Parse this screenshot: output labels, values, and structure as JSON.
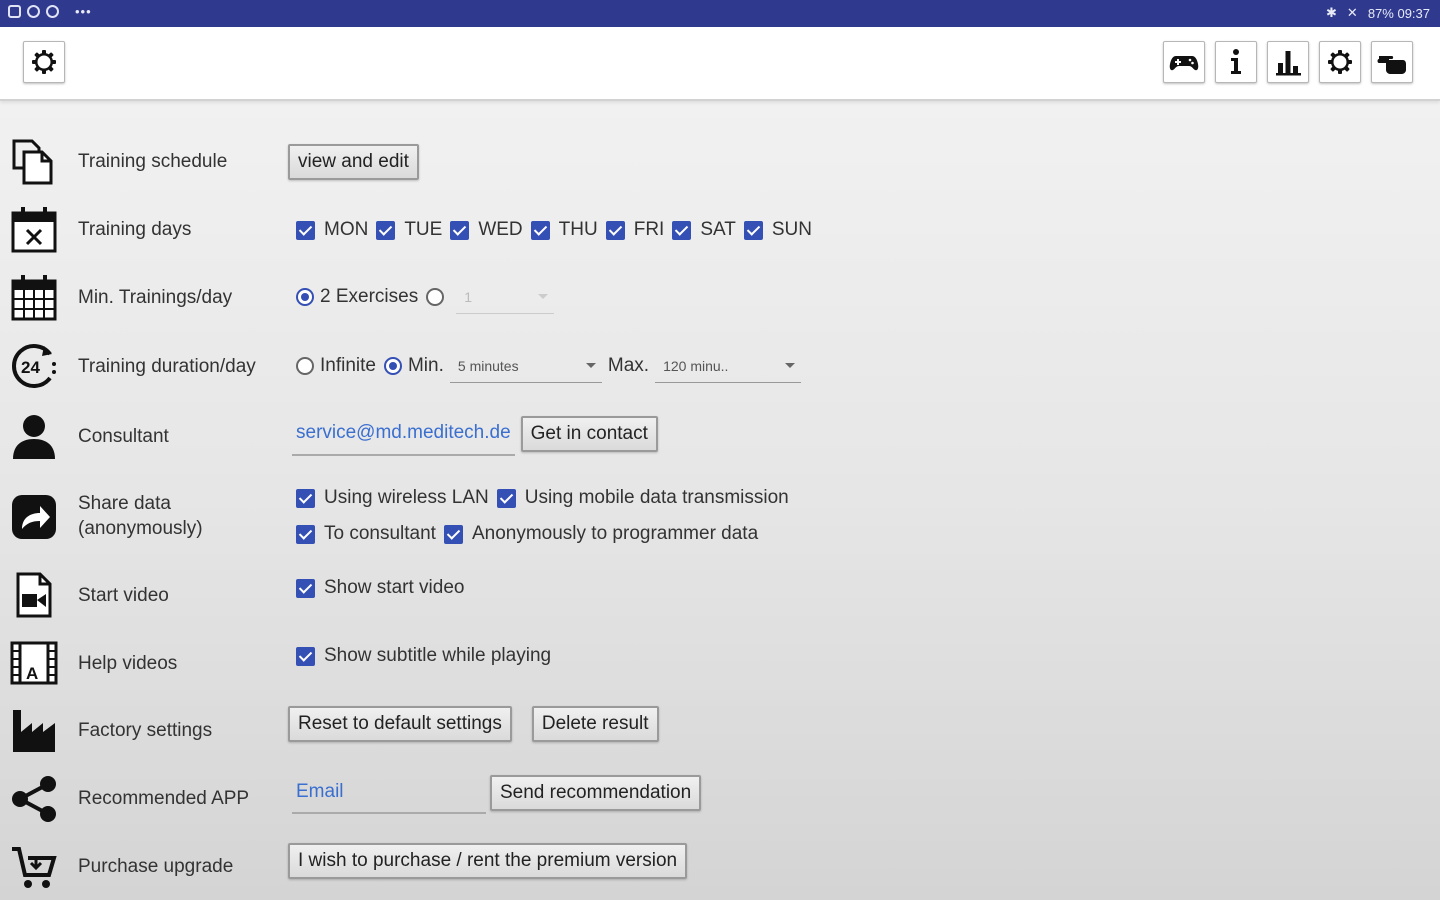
{
  "status_bar": {
    "right": "87% 09:37"
  },
  "toolbar": {
    "left_button": "settings-icon",
    "right_buttons": [
      "gamepad-icon",
      "info-icon",
      "bar-chart-icon",
      "settings-icon",
      "pointer-hand-icon"
    ]
  },
  "rows": {
    "schedule": {
      "label": "Training schedule",
      "button": "view and edit"
    },
    "days": {
      "label": "Training days",
      "options": [
        "MON",
        "TUE",
        "WED",
        "THU",
        "FRI",
        "SAT",
        "SUN"
      ]
    },
    "min_trainings": {
      "label": "Min. Trainings/day",
      "option1": "2 Exercises",
      "spinner_value": "1"
    },
    "duration": {
      "label": "Training duration/day",
      "infinite": "Infinite",
      "min_label": "Min.",
      "min_value": "5 minutes",
      "max_label": "Max.",
      "max_value": "120 minu.."
    },
    "consultant": {
      "label": "Consultant",
      "email": "service@md.meditech.de",
      "button": "Get in contact"
    },
    "share": {
      "label_line1": "Share data",
      "label_line2": "(anonymously)",
      "opt1": "Using wireless LAN",
      "opt2": "Using mobile data transmission",
      "opt3": "To consultant",
      "opt4": "Anonymously to programmer data"
    },
    "start_video": {
      "label": "Start video",
      "option": "Show start video"
    },
    "help_videos": {
      "label": "Help videos",
      "option": "Show subtitle while playing"
    },
    "factory": {
      "label": "Factory settings",
      "reset_button": "Reset to default settings",
      "delete_button": "Delete result"
    },
    "recommend": {
      "label": "Recommended APP",
      "placeholder": "Email",
      "button": "Send recommendation"
    },
    "purchase": {
      "label": "Purchase upgrade",
      "button": "I wish to purchase / rent the premium version"
    }
  },
  "colors": {
    "status_bar": "#2f3a8f",
    "accent": "#3550b5",
    "link": "#3a6fd0"
  }
}
